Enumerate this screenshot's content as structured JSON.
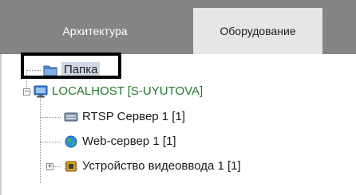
{
  "tabs": [
    {
      "label": "Архитектура",
      "active": false
    },
    {
      "label": "Оборудование",
      "active": true
    }
  ],
  "tree": {
    "folder": {
      "label": "Папка",
      "icon": "folder-icon",
      "selected": true
    },
    "host": {
      "label": "LOCALHOST [S-UYUTOVA]",
      "icon": "monitor-icon",
      "color": "#217a2b"
    },
    "children": [
      {
        "label": "RTSP Сервер 1 [1]",
        "icon": "server-icon"
      },
      {
        "label": "Web-сервер 1 [1]",
        "icon": "globe-icon"
      },
      {
        "label": "Устройство видеоввода 1 [1]",
        "icon": "chip-icon",
        "expandable": true
      }
    ]
  },
  "colors": {
    "tab_bar": "#858585",
    "active_tab": "#e6e6e6",
    "highlight": "#000000"
  }
}
